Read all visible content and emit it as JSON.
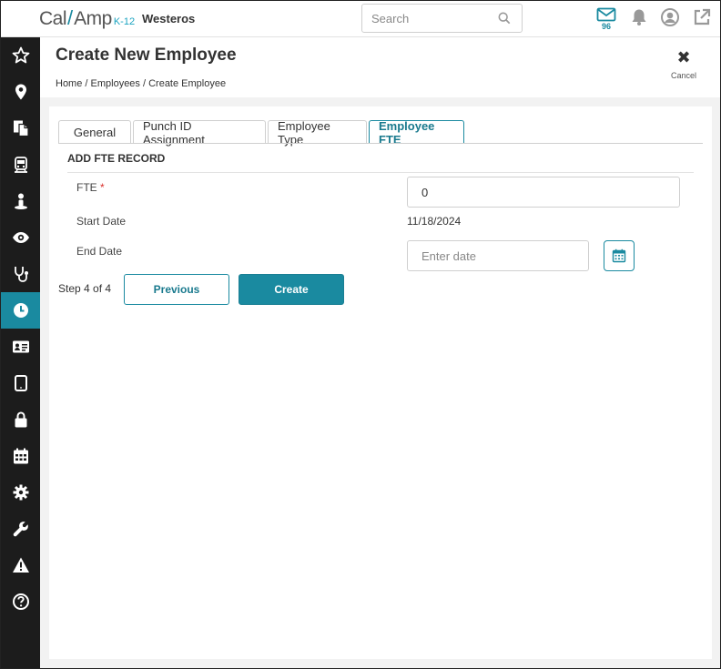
{
  "app": {
    "logo_main": "Cal",
    "logo_slash": "/",
    "logo_second": "Amp",
    "logo_suffix": "K-12",
    "org_name": "Westeros"
  },
  "search": {
    "placeholder": "Search",
    "icon": "search-icon"
  },
  "topbar": {
    "mail_count": "96",
    "icons": [
      "mail-icon",
      "bell-icon",
      "user-circle-icon",
      "external-link-icon"
    ]
  },
  "sidebar": {
    "items": [
      {
        "icon": "star-icon"
      },
      {
        "icon": "map-pin-icon"
      },
      {
        "icon": "documents-icon"
      },
      {
        "icon": "bus-icon"
      },
      {
        "icon": "person-icon"
      },
      {
        "icon": "eye-icon"
      },
      {
        "icon": "stethoscope-icon"
      },
      {
        "icon": "clock-icon",
        "active": true
      },
      {
        "icon": "id-card-icon"
      },
      {
        "icon": "tablet-icon"
      },
      {
        "icon": "lock-icon"
      },
      {
        "icon": "calendar-icon"
      },
      {
        "icon": "gear-icon"
      },
      {
        "icon": "wrench-icon"
      },
      {
        "icon": "warning-icon"
      },
      {
        "icon": "help-icon"
      }
    ]
  },
  "page": {
    "title": "Create New Employee",
    "breadcrumb": "Home / Employees / Create Employee",
    "cancel_label": "Cancel"
  },
  "tabs": [
    {
      "label": "General"
    },
    {
      "label": "Punch ID Assignment"
    },
    {
      "label": "Employee Type"
    },
    {
      "label": "Employee FTE",
      "active": true
    }
  ],
  "form": {
    "section_title": "ADD FTE RECORD",
    "fte_label": "FTE",
    "fte_required_mark": "*",
    "fte_value": "0",
    "start_date_label": "Start Date",
    "start_date_value": "11/18/2024",
    "end_date_label": "End Date",
    "end_date_placeholder": "Enter date"
  },
  "footer": {
    "step_text": "Step 4 of 4",
    "previous_label": "Previous",
    "create_label": "Create"
  },
  "colors": {
    "accent": "#1a8aa0",
    "sidebar_bg": "#1c1c1c",
    "required": "#d9302c"
  }
}
